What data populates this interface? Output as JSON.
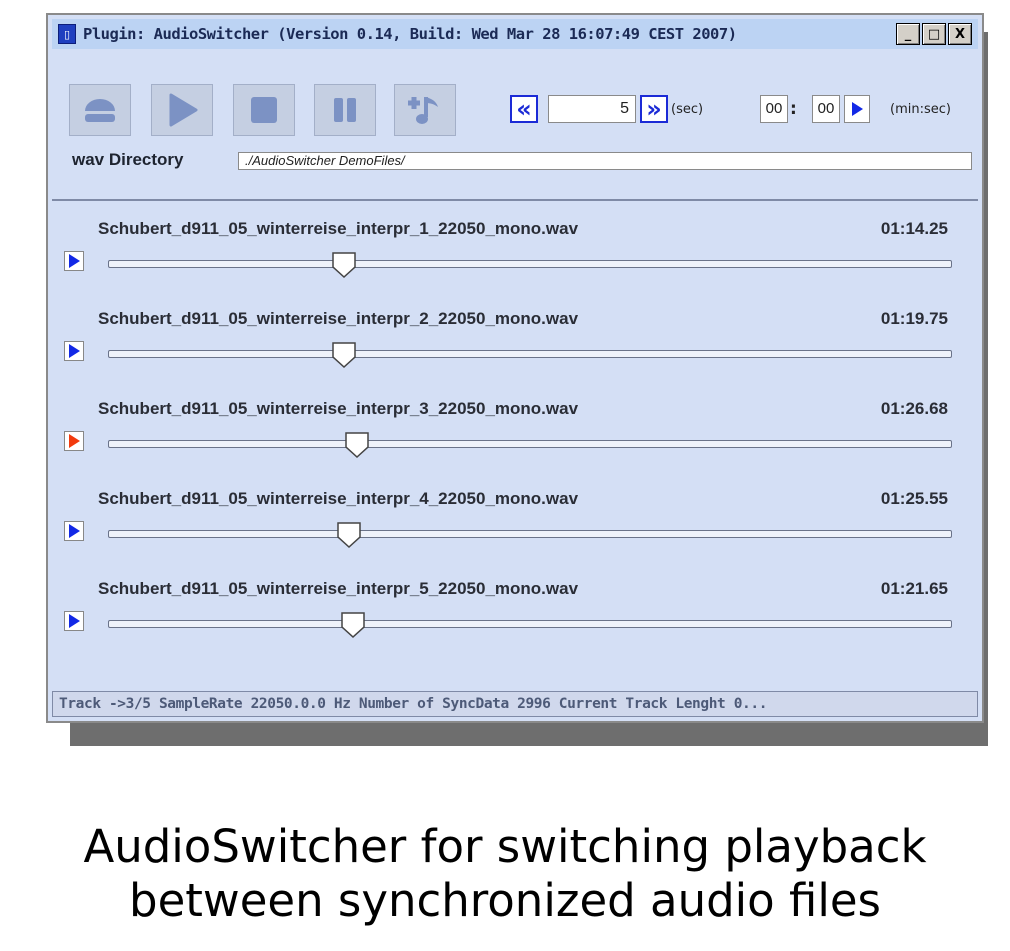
{
  "window": {
    "title": "Plugin: AudioSwitcher (Version 0.14, Build: Wed Mar 28 16:07:49 CEST 2007)",
    "minimize_label": "_",
    "maximize_label": "□",
    "close_label": "X"
  },
  "toolbar": {
    "buttons": [
      "eject-icon",
      "play-icon",
      "stop-icon",
      "pause-icon",
      "music-add-icon"
    ],
    "rewind_label": "«",
    "forward_label": "»",
    "seconds_value": "5",
    "seconds_unit": "(sec)",
    "minutes_value": "00",
    "seconds_time_value": "00",
    "time_separator": ":",
    "time_unit": "(min:sec)"
  },
  "directory": {
    "label": "wav Directory",
    "value": "./AudioSwitcher DemoFiles/"
  },
  "tracks": [
    {
      "name": "Schubert_d911_05_winterreise_interpr_1_22050_mono.wav",
      "time": "01:14.25",
      "active": false,
      "position": 0.28
    },
    {
      "name": "Schubert_d911_05_winterreise_interpr_2_22050_mono.wav",
      "time": "01:19.75",
      "active": false,
      "position": 0.28
    },
    {
      "name": "Schubert_d911_05_winterreise_interpr_3_22050_mono.wav",
      "time": "01:26.68",
      "active": true,
      "position": 0.295
    },
    {
      "name": "Schubert_d911_05_winterreise_interpr_4_22050_mono.wav",
      "time": "01:25.55",
      "active": false,
      "position": 0.285
    },
    {
      "name": "Schubert_d911_05_winterreise_interpr_5_22050_mono.wav",
      "time": "01:21.65",
      "active": false,
      "position": 0.29
    }
  ],
  "statusbar": {
    "text": "Track ->3/5  SampleRate  22050.0.0 Hz   Number of SyncData  2996   Current Track Lenght  0..."
  },
  "caption": {
    "line1": "AudioSwitcher for switching playback",
    "line2": "between synchronized audio files"
  },
  "colors": {
    "window_bg": "#d4dff5",
    "play_inactive": "#1228e6",
    "play_active": "#f23a0e"
  }
}
